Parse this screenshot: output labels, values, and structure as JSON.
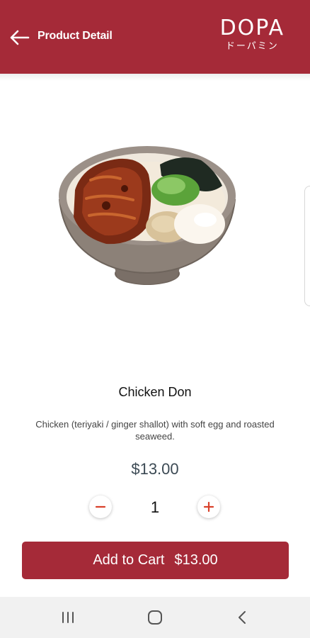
{
  "app_bar": {
    "title": "Product Detail",
    "background": "#a52a38",
    "back_icon": "arrow-left-icon",
    "logo": {
      "main": "DOPA",
      "sub": "ドーパミン"
    }
  },
  "product": {
    "image": "chicken-don-bowl",
    "name": "Chicken Don",
    "description": "Chicken (teriyaki / ginger shallot) with soft egg and roasted seaweed.",
    "price": "$13.00"
  },
  "quantity": {
    "value": "1",
    "decrement_icon": "minus-icon",
    "increment_icon": "plus-icon",
    "accent": "#d9412b"
  },
  "cart_button": {
    "label": "Add to Cart",
    "total": "$13.00"
  },
  "nav_bar": {
    "icons": [
      "recent-apps-icon",
      "home-icon",
      "back-icon"
    ]
  }
}
